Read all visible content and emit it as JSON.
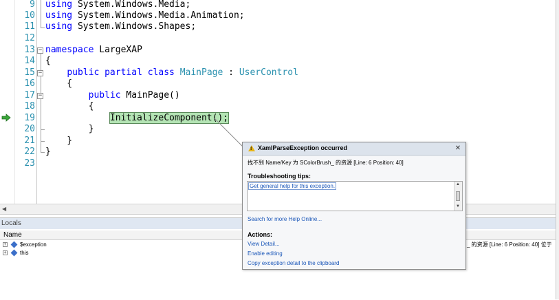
{
  "editor": {
    "lines": [
      {
        "num": "9",
        "text": "using System.Windows.Media;"
      },
      {
        "num": "10",
        "text": "using System.Windows.Media.Animation;"
      },
      {
        "num": "11",
        "text": "using System.Windows.Shapes;"
      },
      {
        "num": "12",
        "text": ""
      },
      {
        "num": "13",
        "text": "namespace LargeXAP"
      },
      {
        "num": "14",
        "text": "{"
      },
      {
        "num": "15",
        "text": "public partial class MainPage : UserControl"
      },
      {
        "num": "16",
        "text": "{"
      },
      {
        "num": "17",
        "text": "public MainPage()"
      },
      {
        "num": "18",
        "text": "{"
      },
      {
        "num": "19",
        "text": "InitializeComponent();"
      },
      {
        "num": "20",
        "text": "}"
      },
      {
        "num": "21",
        "text": "}"
      },
      {
        "num": "22",
        "text": "}"
      },
      {
        "num": "23",
        "text": ""
      }
    ],
    "current_line": "19",
    "colors": {
      "keyword": "#0000ff",
      "type": "#2b91af",
      "highlight": "#b4e4b4"
    }
  },
  "locals": {
    "title": "Locals",
    "column_name": "Name",
    "rows": [
      {
        "name": "$exception",
        "value": "_ 的资源 [Line: 6 Position: 40]   位于"
      },
      {
        "name": "this",
        "value": ""
      }
    ]
  },
  "exception_popup": {
    "title": "XamlParseException occurred",
    "message": "找不到 Name/Key 为 SColorBrush_ 的资源 [Line: 6 Position: 40]",
    "tips_heading": "Troubleshooting tips:",
    "tip_link": "Get general help for this exception.",
    "search_link": "Search for more Help Online...",
    "actions_heading": "Actions:",
    "actions": [
      "View Detail...",
      "Enable editing",
      "Copy exception detail to the clipboard"
    ],
    "close_label": "✕"
  }
}
